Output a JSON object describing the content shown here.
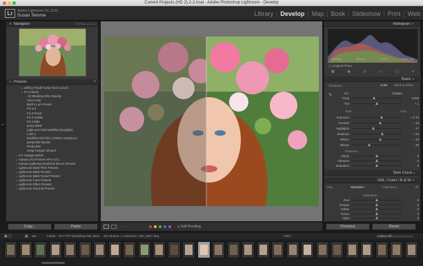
{
  "window": {
    "title": "Current Projects (HD 2).2-2.lrcat - Adobe Photoshop Lightroom - Develop"
  },
  "identity": {
    "app_version": "Adobe Lightroom CC 2015",
    "user_name": "Susan Temme",
    "logo": "Lr"
  },
  "modules": [
    {
      "label": "Library",
      "active": false
    },
    {
      "label": "Develop",
      "active": true
    },
    {
      "label": "Map",
      "active": false
    },
    {
      "label": "Book",
      "active": false
    },
    {
      "label": "Slideshow",
      "active": false
    },
    {
      "label": "Print",
      "active": false
    },
    {
      "label": "Web",
      "active": false
    }
  ],
  "left_panel": {
    "navigator_title": "Navigator",
    "navigator_options": "FIT  FILL  1:1  4:1",
    "presets_title": "Presets",
    "presets": [
      {
        "label": "Jeffrey Friedl Funky Tone Curves",
        "level": 1,
        "arrow": "▸"
      },
      {
        "label": "K's Actions",
        "level": 1,
        "arrow": "▾"
      },
      {
        "label": "-10 Masking 30% Opacity",
        "level": 2,
        "arrow": ""
      },
      {
        "label": "Auto Crisp",
        "level": 2,
        "arrow": ""
      },
      {
        "label": "Beth's Lum Preset",
        "level": 2,
        "arrow": ""
      },
      {
        "label": "Fix 8.2",
        "level": 2,
        "arrow": ""
      },
      {
        "label": "Fix 8 Fixed",
        "level": 2,
        "arrow": ""
      },
      {
        "label": "Fix 8 Subtle",
        "level": 2,
        "arrow": ""
      },
      {
        "label": "KS Inside",
        "level": 2,
        "arrow": ""
      },
      {
        "label": "Ipsey B&W",
        "level": 2,
        "arrow": ""
      },
      {
        "label": "Light and Vivid Modified (Daylight)",
        "level": 2,
        "arrow": ""
      },
      {
        "label": "Look 1",
        "level": 2,
        "arrow": ""
      },
      {
        "label": "Modified Old Film 4 (Warm Outdoors)",
        "level": 2,
        "arrow": ""
      },
      {
        "label": "pretty BW blacker",
        "level": 2,
        "arrow": ""
      },
      {
        "label": "Pretty BW",
        "level": 2,
        "arrow": ""
      },
      {
        "label": "Snap Oxygen infused",
        "level": 2,
        "arrow": ""
      },
      {
        "label": "KIT Vintage Delish",
        "level": 0,
        "arrow": "▸"
      },
      {
        "label": "Kubota LR2 Presets XPS V3.1",
        "level": 0,
        "arrow": "▸"
      },
      {
        "label": "Kubota Lightning Notebook Bonus Presets",
        "level": 0,
        "arrow": "▸"
      },
      {
        "label": "Lightroom B&W Filter Presets",
        "level": 0,
        "arrow": "▸"
      },
      {
        "label": "Lightroom B&W Presets",
        "level": 0,
        "arrow": "▸"
      },
      {
        "label": "Lightroom B&W Toned Presets",
        "level": 0,
        "arrow": "▸"
      },
      {
        "label": "Lightroom Color Presets",
        "level": 0,
        "arrow": "▸"
      },
      {
        "label": "Lightroom Effect Presets",
        "level": 0,
        "arrow": "▸"
      },
      {
        "label": "Lightroom General Presets",
        "level": 0,
        "arrow": "▸"
      }
    ],
    "copy_label": "Copy...",
    "paste_label": "Paste"
  },
  "toolbar": {
    "soft_proofing_label": "Soft Proofing",
    "flag_colors": [
      "#d23b3b",
      "#e2c43a",
      "#53b14c",
      "#3d7ad6",
      "#9b4fc9"
    ]
  },
  "right_panel": {
    "histogram_title": "Histogram",
    "histogram_info": [
      "ISO 800",
      "85 mm",
      "f / 2.8",
      "1/250 sec"
    ],
    "original_photo_label": "Original Photo",
    "basic_title": "Basic",
    "treatment_label": "Treatment :",
    "treatment_color": "Color",
    "treatment_bw": "Black & White",
    "wb_label": "WB :",
    "wb_value": "Custom",
    "tone_label": "Tone",
    "tone_auto": "Auto",
    "presence_label": "Presence",
    "sliders_wb": [
      {
        "label": "Temp",
        "value": "3,890",
        "pos": 0.45
      },
      {
        "label": "Tint",
        "value": "+ 1",
        "pos": 0.5
      }
    ],
    "sliders_tone": [
      {
        "label": "Exposure",
        "value": "+ 0.70",
        "pos": 0.6
      },
      {
        "label": "Contrast",
        "value": "+ 19",
        "pos": 0.58
      },
      {
        "label": "Highlights",
        "value": "- 17",
        "pos": 0.44
      },
      {
        "label": "Shadows",
        "value": "+ 34",
        "pos": 0.62
      },
      {
        "label": "Whites",
        "value": "+ 20",
        "pos": 0.58
      },
      {
        "label": "Blacks",
        "value": "- 40",
        "pos": 0.35
      }
    ],
    "sliders_presence": [
      {
        "label": "Clarity",
        "value": "0",
        "pos": 0.5
      },
      {
        "label": "Vibrance",
        "value": "0",
        "pos": 0.5
      },
      {
        "label": "Saturation",
        "value": "0",
        "pos": 0.5
      }
    ],
    "tone_curve_title": "Tone Curve",
    "hsl_title": "HSL / Color / B & W",
    "hsl_tabs": [
      "Hue",
      "Saturation",
      "Luminance",
      "All"
    ],
    "hsl_section": "Saturation",
    "sliders_hsl": [
      {
        "label": "Red",
        "value": "0",
        "pos": 0.5
      },
      {
        "label": "Orange",
        "value": "0",
        "pos": 0.5
      },
      {
        "label": "Yellow",
        "value": "0",
        "pos": 0.5
      },
      {
        "label": "Green",
        "value": "0",
        "pos": 0.5
      },
      {
        "label": "Aqua",
        "value": "0",
        "pos": 0.5
      }
    ],
    "previous_label": "Previous",
    "reset_label": "Reset"
  },
  "filmstrip": {
    "source_label": "Folder : JFX PTP Workshop Mar 2015",
    "count_label": "457 photos / 1 selected /_MG_0817.dng",
    "filter_label": "Filter :",
    "filter_value": "Filters Off",
    "thumb_count": 28,
    "selected_index": 13
  }
}
